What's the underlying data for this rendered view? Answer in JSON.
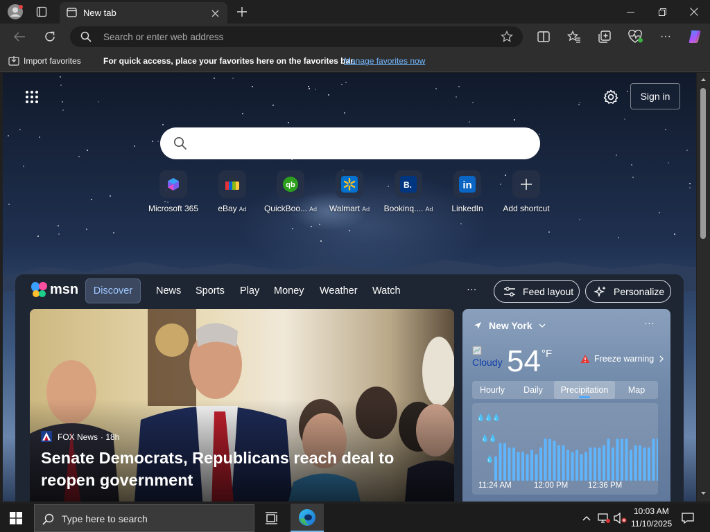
{
  "browser": {
    "tab_title": "New tab",
    "address_placeholder": "Search or enter web address",
    "window_controls": [
      "minimize-icon",
      "restore-icon",
      "close-icon"
    ]
  },
  "favorites_bar": {
    "import_label": "Import favorites",
    "message": "For quick access, place your favorites here on the favorites bar.",
    "manage_link": "Manage favorites now"
  },
  "newtab": {
    "sign_in": "Sign in",
    "shortcuts": [
      {
        "name": "Microsoft 365",
        "ad": "",
        "icon": "microsoft-365-icon",
        "color": "#3a7bd5"
      },
      {
        "name": "eBay",
        "ad": "Ad",
        "icon": "ebay-icon",
        "color": "#e53238"
      },
      {
        "name": "QuickBoo...",
        "ad": "Ad",
        "icon": "quickbooks-icon",
        "color": "#2ca01c"
      },
      {
        "name": "Walmart",
        "ad": "Ad",
        "icon": "walmart-icon",
        "color": "#0071ce"
      },
      {
        "name": "Bookinq....",
        "ad": "Ad",
        "icon": "booking-icon",
        "color": "#003580"
      },
      {
        "name": "LinkedIn",
        "ad": "",
        "icon": "linkedin-icon",
        "color": "#0a66c2"
      },
      {
        "name": "Add shortcut",
        "ad": "",
        "icon": "plus-icon",
        "color": "#555b66"
      }
    ]
  },
  "msn": {
    "logo": "msn",
    "nav": [
      "Discover",
      "News",
      "Sports",
      "Play",
      "Money",
      "Weather",
      "Watch"
    ],
    "more": "···",
    "feed_layout": "Feed layout",
    "personalize": "Personalize",
    "hero": {
      "source": "FOX News",
      "age": "· 18h",
      "headline": "Senate Democrats, Republicans reach deal to reopen government"
    },
    "weather": {
      "location": "New York",
      "more": "···",
      "condition_alt": "Cloudy",
      "temperature": "54",
      "unit": "°F",
      "alert": "Freeze warning",
      "tabs": [
        "Hourly",
        "Daily",
        "Precipitation",
        "Map"
      ],
      "active_tab": "Precipitation",
      "times": [
        "11:24 AM",
        "12:00 PM",
        "12:36 PM"
      ],
      "precip_levels": [
        0.55,
        0.85,
        0.85,
        0.75,
        0.75,
        0.65,
        0.65,
        0.6,
        0.7,
        0.6,
        0.75,
        0.95,
        0.95,
        0.9,
        0.8,
        0.8,
        0.7,
        0.65,
        0.7,
        0.6,
        0.65,
        0.75,
        0.75,
        0.75,
        0.8,
        0.95,
        0.75,
        0.95,
        0.95,
        0.95,
        0.7,
        0.8,
        0.8,
        0.75,
        0.75,
        0.95,
        0.95
      ]
    }
  },
  "taskbar": {
    "search_placeholder": "Type here to search",
    "time": "10:03 AM",
    "date": "11/10/2025"
  }
}
